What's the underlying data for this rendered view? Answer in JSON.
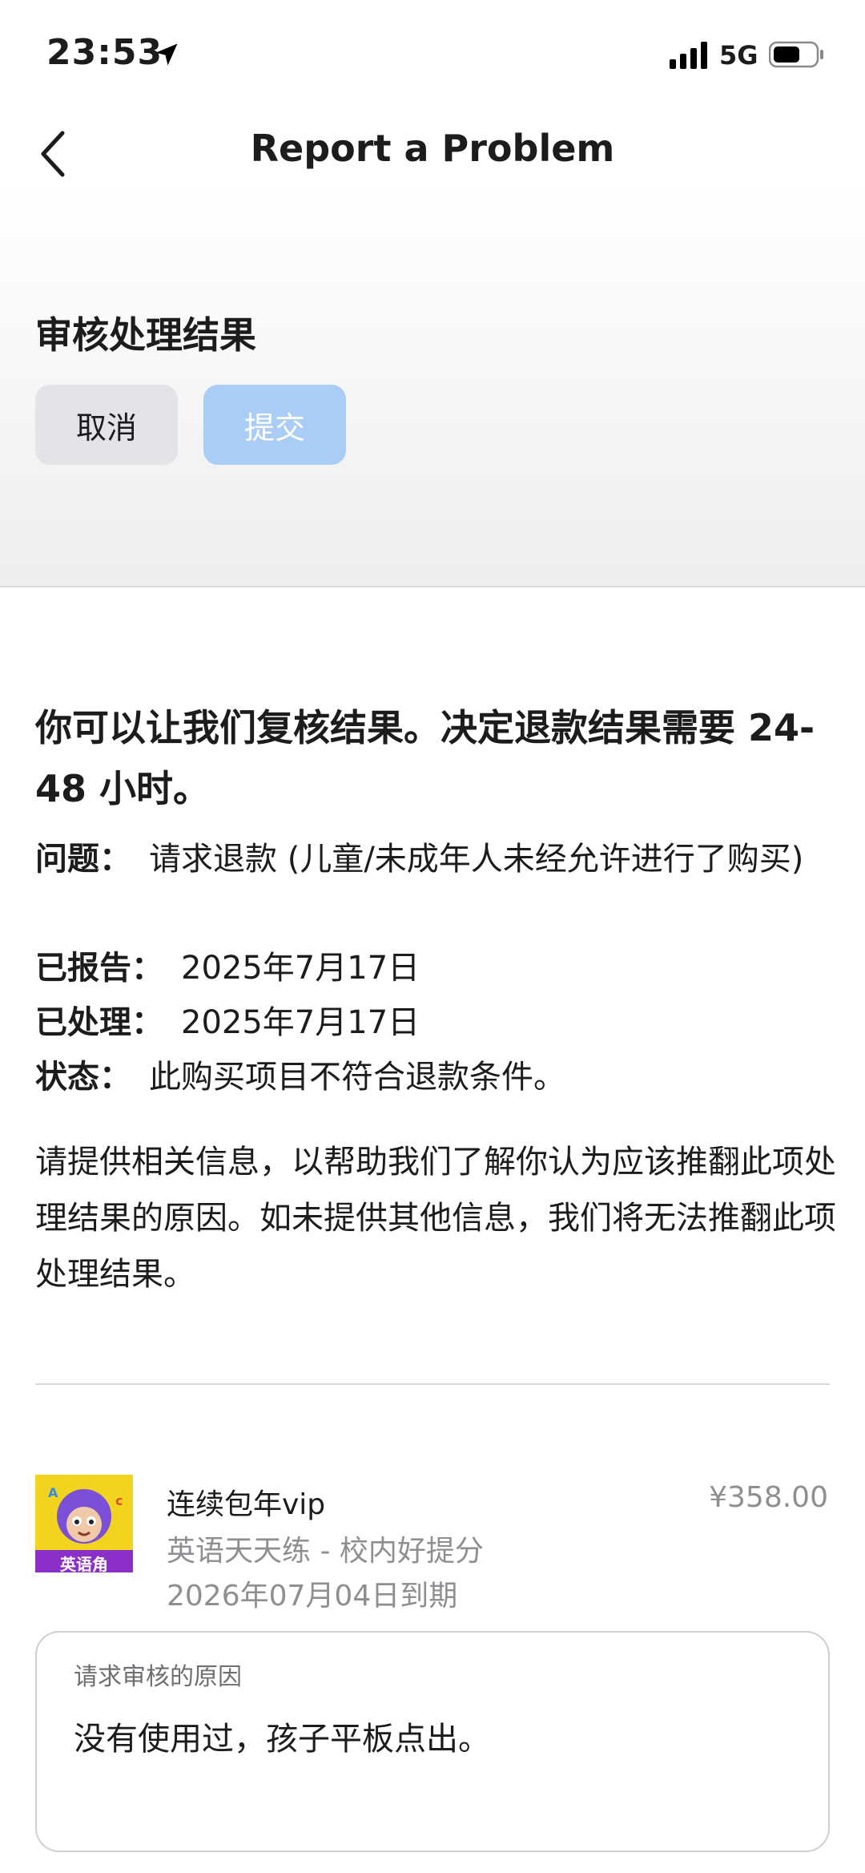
{
  "status_bar": {
    "time": "23:53",
    "network": "5G",
    "icons": [
      "location-arrow-icon",
      "signal-bars-icon",
      "battery-icon"
    ]
  },
  "nav": {
    "back_icon": "chevron-left-icon",
    "title": "Report a Problem"
  },
  "review": {
    "section_title": "审核处理结果",
    "cancel_label": "取消",
    "submit_label": "提交"
  },
  "content": {
    "lead": "你可以让我们复核结果。决定退款结果需要 24-48 小时。",
    "issue_key": "问题：",
    "issue_value": "请求退款 (儿童/未成年人未经允许进行了购买)",
    "reported_key": "已报告：",
    "reported_value": "2025年7月17日",
    "processed_key": "已处理：",
    "processed_value": "2025年7月17日",
    "status_key": "状态：",
    "status_value": "此购买项目不符合退款条件。",
    "instruction": "请提供相关信息，以帮助我们了解你认为应该推翻此项处理结果的原因。如未提供其他信息，我们将无法推翻此项处理结果。"
  },
  "purchase": {
    "icon_text": "英语角",
    "name": "连续包年vip",
    "price": "¥358.00",
    "app_name": "英语天天练 - 校内好提分",
    "expiry": "2026年07月04日到期"
  },
  "reason": {
    "label": "请求审核的原因",
    "value": "没有使用过，孩子平板点出。"
  },
  "colors": {
    "submit_disabled": "#a9cdf4",
    "cancel_bg": "#e3e3e8",
    "secondary_text": "#8e8e93"
  }
}
